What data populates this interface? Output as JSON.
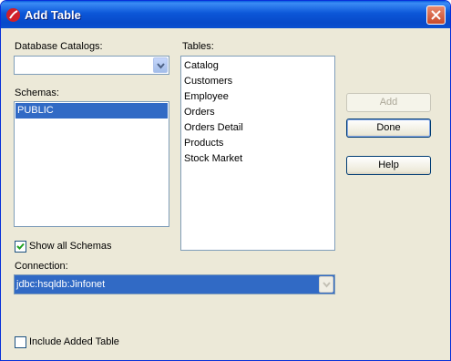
{
  "window": {
    "title": "Add Table"
  },
  "labels": {
    "database_catalogs": "Database Catalogs:",
    "tables": "Tables:",
    "schemas": "Schemas:",
    "show_all_schemas": "Show all Schemas",
    "connection": "Connection:",
    "include_added_table": "Include Added Table"
  },
  "catalog_combo": {
    "value": ""
  },
  "schemas": [
    {
      "label": "PUBLIC",
      "selected": true
    }
  ],
  "tables": [
    {
      "label": "Catalog"
    },
    {
      "label": "Customers"
    },
    {
      "label": "Employee"
    },
    {
      "label": "Orders"
    },
    {
      "label": "Orders Detail"
    },
    {
      "label": "Products"
    },
    {
      "label": "Stock Market"
    }
  ],
  "connection": {
    "value": "jdbc:hsqldb:Jinfonet"
  },
  "checkboxes": {
    "show_all_schemas": true,
    "include_added_table": false
  },
  "buttons": {
    "add": "Add",
    "done": "Done",
    "help": "Help"
  },
  "icons": {
    "app": "app-logo-icon",
    "close": "close-icon",
    "dropdown": "chevron-down-icon",
    "check": "checkmark-icon"
  },
  "colors": {
    "title_bar": "#0c57d8",
    "selection": "#316ac5",
    "dialog_bg": "#ece9d8"
  }
}
